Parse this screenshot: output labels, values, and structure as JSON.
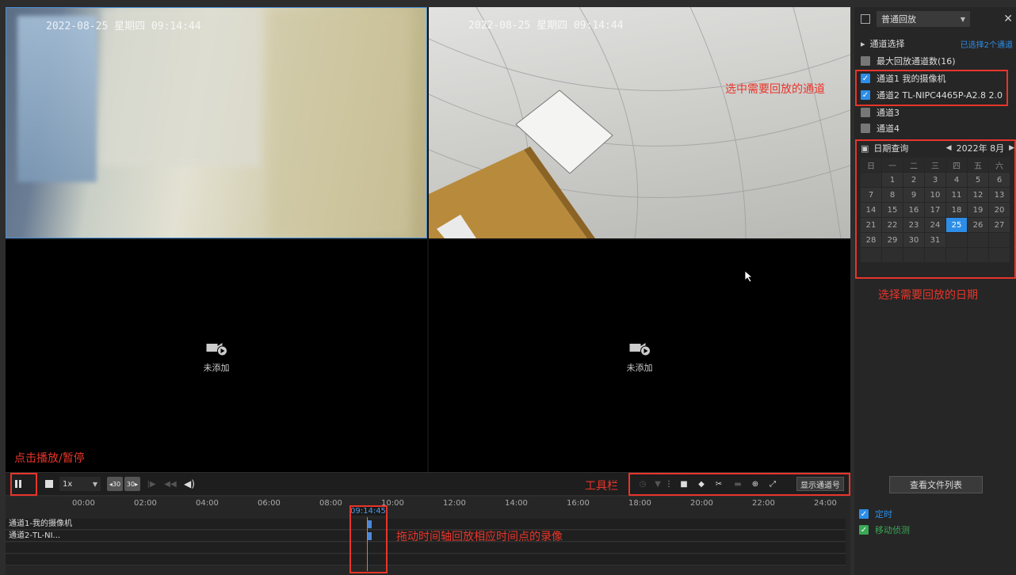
{
  "playback_mode": "普通回放",
  "channel_select": {
    "title": "通道选择",
    "selected_summary": "已选择2个通道",
    "max_label": "最大回放通道数(16)",
    "channels": [
      {
        "label": "通道1 我的摄像机",
        "checked": true
      },
      {
        "label": "通道2 TL-NIPC4465P-A2.8 2.0",
        "checked": true
      },
      {
        "label": "通道3",
        "checked": false
      },
      {
        "label": "通道4",
        "checked": false
      }
    ]
  },
  "date_query": {
    "title": "日期查询",
    "month": "2022年 8月",
    "weekdays": [
      "日",
      "一",
      "二",
      "三",
      "四",
      "五",
      "六"
    ],
    "weeks": [
      [
        "",
        "1",
        "2",
        "3",
        "4",
        "5",
        "6"
      ],
      [
        "7",
        "8",
        "9",
        "10",
        "11",
        "12",
        "13"
      ],
      [
        "14",
        "15",
        "16",
        "17",
        "18",
        "19",
        "20"
      ],
      [
        "21",
        "22",
        "23",
        "24",
        "25",
        "26",
        "27"
      ],
      [
        "28",
        "29",
        "30",
        "31",
        "",
        "",
        ""
      ],
      [
        "",
        "",
        "",
        "",
        "",
        "",
        ""
      ]
    ],
    "selected_day": "25"
  },
  "video": {
    "osd1": "2022-08-25 星期四 09:14:44",
    "osd2": "2022-08-25 星期四 09:14:44",
    "empty_label": "未添加"
  },
  "annotations": {
    "select_channel": "选中需要回放的通道",
    "select_date": "选择需要回放的日期",
    "play_pause": "点击播放/暂停",
    "toolbar": "工具栏",
    "drag_timeline": "拖动时间轴回放相应时间点的录像"
  },
  "playbar": {
    "speed": "1x",
    "back30": "◂30",
    "fwd30": "30▸",
    "show_channel": "显示通道号",
    "file_list": "查看文件列表"
  },
  "timeline": {
    "ticks": [
      "00:00",
      "02:00",
      "04:00",
      "06:00",
      "08:00",
      "10:00",
      "12:00",
      "14:00",
      "16:00",
      "18:00",
      "20:00",
      "22:00",
      "24:00"
    ],
    "current_time": "09:14:45",
    "tracks": [
      "通道1-我的摄像机",
      "通道2-TL-NI..."
    ]
  },
  "legend": {
    "timed": "定时",
    "motion": "移动侦测"
  },
  "colors": {
    "accent": "#2d8ee8",
    "annotation": "#e8352a",
    "record": "#4f86d6",
    "timed": "#2d8ee8",
    "motion": "#3aa855"
  }
}
